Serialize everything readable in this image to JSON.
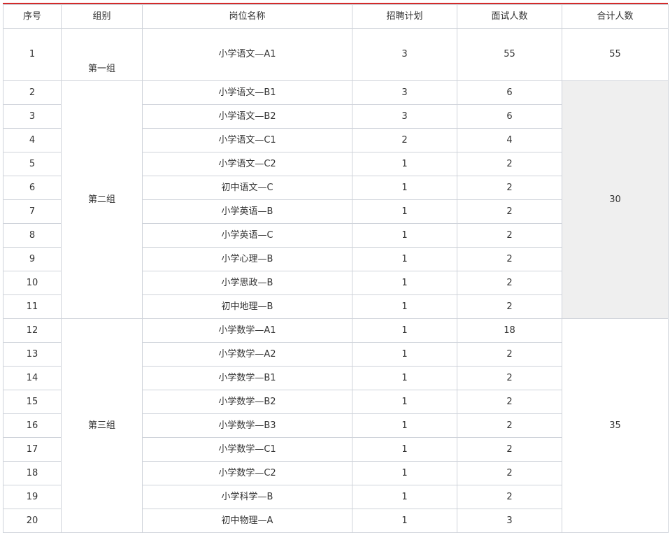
{
  "headers": [
    "序号",
    "组别",
    "岗位名称",
    "招聘计划",
    "面试人数",
    "合计人数"
  ],
  "groups": [
    {
      "name": "第一组",
      "total": "55"
    },
    {
      "name": "第二组",
      "total": "30"
    },
    {
      "name": "第三组",
      "total": "35"
    }
  ],
  "rows": [
    {
      "no": "1",
      "post": "小学语文—A1",
      "plan": "3",
      "count": "55"
    },
    {
      "no": "2",
      "post": "小学语文—B1",
      "plan": "3",
      "count": "6"
    },
    {
      "no": "3",
      "post": "小学语文—B2",
      "plan": "3",
      "count": "6"
    },
    {
      "no": "4",
      "post": "小学语文—C1",
      "plan": "2",
      "count": "4"
    },
    {
      "no": "5",
      "post": "小学语文—C2",
      "plan": "1",
      "count": "2"
    },
    {
      "no": "6",
      "post": "初中语文—C",
      "plan": "1",
      "count": "2"
    },
    {
      "no": "7",
      "post": "小学英语—B",
      "plan": "1",
      "count": "2"
    },
    {
      "no": "8",
      "post": "小学英语—C",
      "plan": "1",
      "count": "2"
    },
    {
      "no": "9",
      "post": "小学心理—B",
      "plan": "1",
      "count": "2"
    },
    {
      "no": "10",
      "post": "小学思政—B",
      "plan": "1",
      "count": "2"
    },
    {
      "no": "11",
      "post": "初中地理—B",
      "plan": "1",
      "count": "2"
    },
    {
      "no": "12",
      "post": "小学数学—A1",
      "plan": "1",
      "count": "18"
    },
    {
      "no": "13",
      "post": "小学数学—A2",
      "plan": "1",
      "count": "2"
    },
    {
      "no": "14",
      "post": "小学数学—B1",
      "plan": "1",
      "count": "2"
    },
    {
      "no": "15",
      "post": "小学数学—B2",
      "plan": "1",
      "count": "2"
    },
    {
      "no": "16",
      "post": "小学数学—B3",
      "plan": "1",
      "count": "2"
    },
    {
      "no": "17",
      "post": "小学数学—C1",
      "plan": "1",
      "count": "2"
    },
    {
      "no": "18",
      "post": "小学数学—C2",
      "plan": "1",
      "count": "2"
    },
    {
      "no": "19",
      "post": "小学科学—B",
      "plan": "1",
      "count": "2"
    },
    {
      "no": "20",
      "post": "初中物理—A",
      "plan": "1",
      "count": "3"
    }
  ]
}
